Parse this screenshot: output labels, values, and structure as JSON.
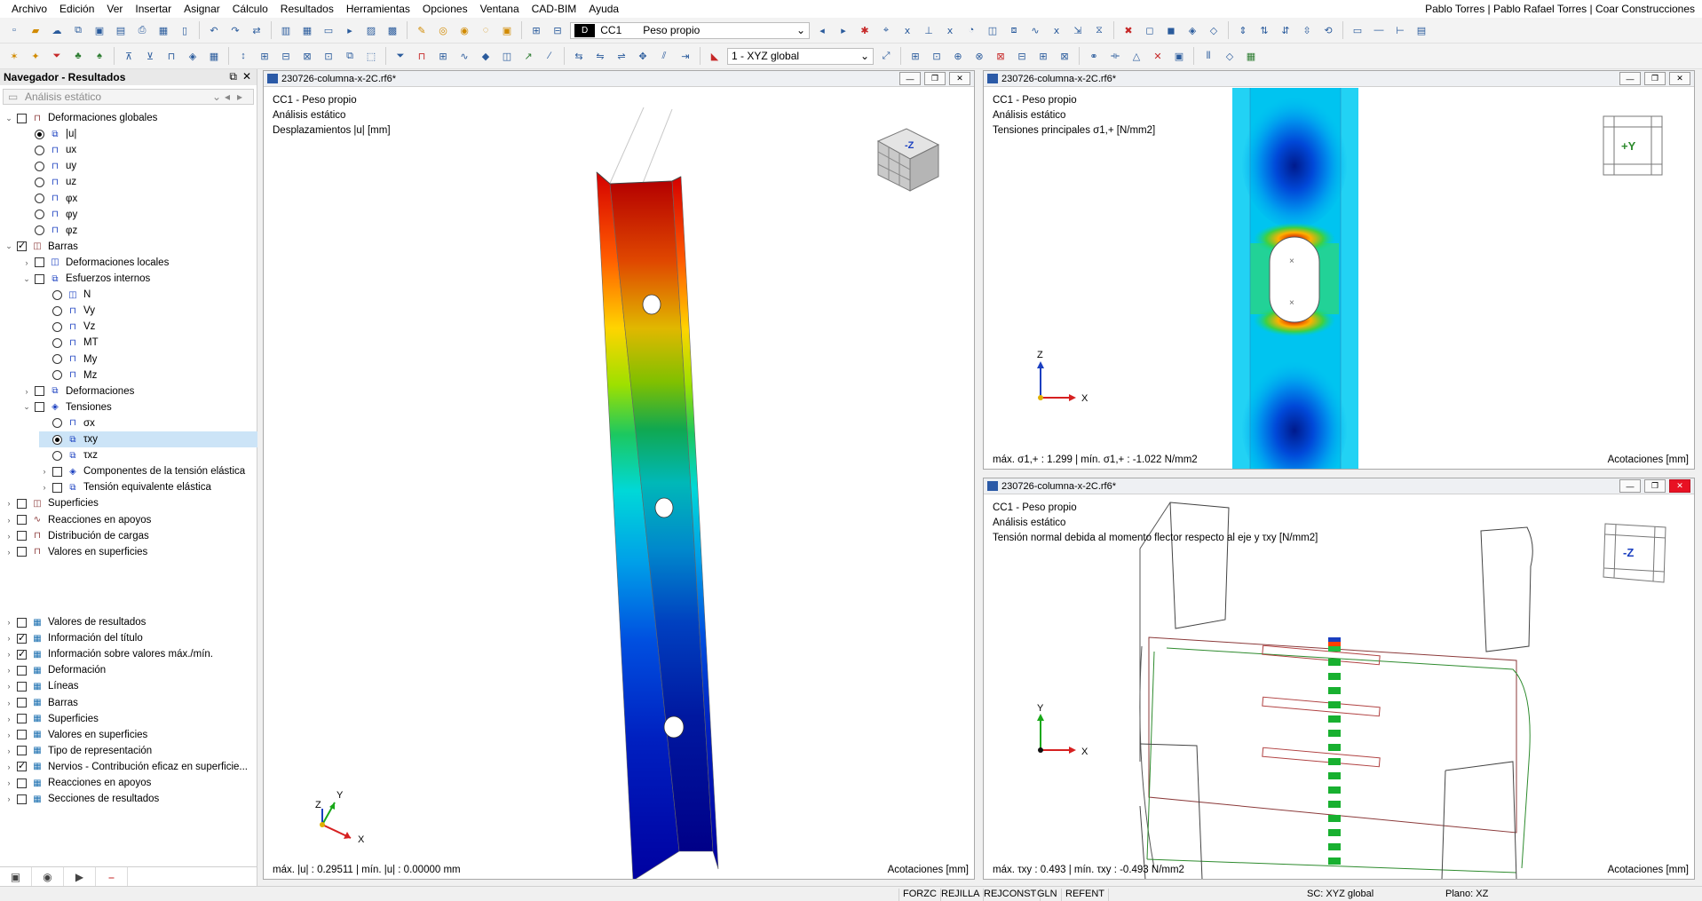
{
  "menu": [
    "Archivo",
    "Edición",
    "Ver",
    "Insertar",
    "Asignar",
    "Cálculo",
    "Resultados",
    "Herramientas",
    "Opciones",
    "Ventana",
    "CAD-BIM",
    "Ayuda"
  ],
  "user": "Pablo Torres | Pablo Rafael Torres | Coar Construcciones",
  "toolbar": {
    "lc_badge": "D",
    "lc_code": "CC1",
    "lc_name": "Peso propio",
    "cs_combo": "1 - XYZ global"
  },
  "navigator": {
    "title": "Navegador - Resultados",
    "analysis_combo": "Análisis estático",
    "tree": [
      {
        "label": "Deformaciones globales",
        "level": 0,
        "ctrl": "cb",
        "on": false,
        "exp": "v"
      },
      {
        "label": "|u|",
        "level": 1,
        "ctrl": "rb",
        "on": true
      },
      {
        "label": "ux",
        "level": 1,
        "ctrl": "rb",
        "on": false
      },
      {
        "label": "uy",
        "level": 1,
        "ctrl": "rb",
        "on": false
      },
      {
        "label": "uz",
        "level": 1,
        "ctrl": "rb",
        "on": false
      },
      {
        "label": "φx",
        "level": 1,
        "ctrl": "rb",
        "on": false
      },
      {
        "label": "φy",
        "level": 1,
        "ctrl": "rb",
        "on": false
      },
      {
        "label": "φz",
        "level": 1,
        "ctrl": "rb",
        "on": false
      },
      {
        "label": "Barras",
        "level": 0,
        "ctrl": "cb",
        "on": true,
        "exp": "v"
      },
      {
        "label": "Deformaciones locales",
        "level": 1,
        "ctrl": "cb",
        "on": false,
        "exp": ">"
      },
      {
        "label": "Esfuerzos internos",
        "level": 1,
        "ctrl": "cb",
        "on": false,
        "exp": "v"
      },
      {
        "label": "N",
        "level": 2,
        "ctrl": "rb",
        "on": false
      },
      {
        "label": "Vy",
        "level": 2,
        "ctrl": "rb",
        "on": false
      },
      {
        "label": "Vz",
        "level": 2,
        "ctrl": "rb",
        "on": false
      },
      {
        "label": "MT",
        "level": 2,
        "ctrl": "rb",
        "on": false
      },
      {
        "label": "My",
        "level": 2,
        "ctrl": "rb",
        "on": false
      },
      {
        "label": "Mz",
        "level": 2,
        "ctrl": "rb",
        "on": false
      },
      {
        "label": "Deformaciones",
        "level": 1,
        "ctrl": "cb",
        "on": false,
        "exp": ">"
      },
      {
        "label": "Tensiones",
        "level": 1,
        "ctrl": "cb",
        "on": false,
        "exp": "v"
      },
      {
        "label": "σx",
        "level": 2,
        "ctrl": "rb",
        "on": false
      },
      {
        "label": "τxy",
        "level": 2,
        "ctrl": "rb",
        "on": true,
        "selected": true
      },
      {
        "label": "τxz",
        "level": 2,
        "ctrl": "rb",
        "on": false
      },
      {
        "label": "Componentes de la tensión elástica",
        "level": 2,
        "ctrl": "cb",
        "on": false,
        "exp": ">"
      },
      {
        "label": "Tensión equivalente elástica",
        "level": 2,
        "ctrl": "cb",
        "on": false,
        "exp": ">"
      },
      {
        "label": "Superficies",
        "level": 0,
        "ctrl": "cb",
        "on": false,
        "exp": ">"
      },
      {
        "label": "Reacciones en apoyos",
        "level": 0,
        "ctrl": "cb",
        "on": false,
        "exp": ">"
      },
      {
        "label": "Distribución de cargas",
        "level": 0,
        "ctrl": "cb",
        "on": false,
        "exp": ">"
      },
      {
        "label": "Valores en superficies",
        "level": 0,
        "ctrl": "cb",
        "on": false,
        "exp": ">"
      }
    ],
    "tree2": [
      {
        "label": "Valores de resultados",
        "ctrl": "cb",
        "on": false
      },
      {
        "label": "Información del título",
        "ctrl": "cb",
        "on": true
      },
      {
        "label": "Información sobre valores máx./mín.",
        "ctrl": "cb",
        "on": true
      },
      {
        "label": "Deformación",
        "ctrl": "cb",
        "on": false
      },
      {
        "label": "Líneas",
        "ctrl": "cb",
        "on": false
      },
      {
        "label": "Barras",
        "ctrl": "cb",
        "on": false
      },
      {
        "label": "Superficies",
        "ctrl": "cb",
        "on": false
      },
      {
        "label": "Valores en superficies",
        "ctrl": "cb",
        "on": false
      },
      {
        "label": "Tipo de representación",
        "ctrl": "cb",
        "on": false
      },
      {
        "label": "Nervios - Contribución eficaz en superficie...",
        "ctrl": "cb",
        "on": true
      },
      {
        "label": "Reacciones en apoyos",
        "ctrl": "cb",
        "on": false
      },
      {
        "label": "Secciones de resultados",
        "ctrl": "cb",
        "on": false
      }
    ]
  },
  "windows": [
    {
      "title": "230726-columna-x-2C.rf6*",
      "line1": "CC1 - Peso propio",
      "line2": "Análisis estático",
      "line3": "Desplazamientos |u| [mm]",
      "footer_left": "máx. |u| : 0.29511 | mín. |u| : 0.00000 mm",
      "footer_right": "Acotaciones [mm]",
      "cube_label": "-Z"
    },
    {
      "title": "230726-columna-x-2C.rf6*",
      "line1": "CC1 - Peso propio",
      "line2": "Análisis estático",
      "line3": "Tensiones principales σ1,+ [N/mm2]",
      "footer_left": "máx. σ1,+ : 1.299 | mín. σ1,+ : -1.022 N/mm2",
      "footer_right": "Acotaciones [mm]",
      "cube_label": "+Y"
    },
    {
      "title": "230726-columna-x-2C.rf6*",
      "line1": "CC1 - Peso propio",
      "line2": "Análisis estático",
      "line3": "Tensión normal debida al momento flector respecto al eje y τxy [N/mm2]",
      "footer_left": "máx. τxy : 0.493 | mín. τxy : -0.493 N/mm2",
      "footer_right": "Acotaciones [mm]",
      "cube_label": "-Z"
    }
  ],
  "axes": {
    "x": "X",
    "y": "Y",
    "z": "Z"
  },
  "status": {
    "items": [
      "FORZC",
      "REJILLA",
      "REJCONST",
      "GLN",
      "REFENT"
    ],
    "cs": "SC: XYZ global",
    "plane": "Plano: XZ"
  }
}
